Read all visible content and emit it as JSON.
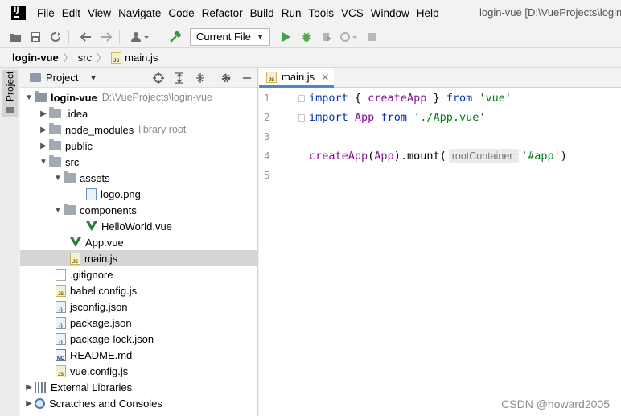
{
  "menu": {
    "items": [
      "File",
      "Edit",
      "View",
      "Navigate",
      "Code",
      "Refactor",
      "Build",
      "Run",
      "Tools",
      "VCS",
      "Window",
      "Help"
    ],
    "window_title": "login-vue [D:\\VueProjects\\login"
  },
  "toolbar": {
    "run_config": "Current File",
    "icons": [
      "open-folder-icon",
      "save-icon",
      "sync-icon",
      "back-arrow-icon",
      "forward-arrow-icon",
      "user-icon",
      "hammer-icon",
      "run-icon",
      "debug-icon",
      "coverage-icon",
      "profile-icon",
      "stop-icon"
    ]
  },
  "breadcrumb": {
    "project": "login-vue",
    "folder": "src",
    "file": "main.js"
  },
  "tool_strip": {
    "project_tab": "Project"
  },
  "project_panel": {
    "title": "Project",
    "tree": [
      {
        "label": "login-vue",
        "hint": "D:\\VueProjects\\login-vue",
        "depth": 0,
        "arrow": "down",
        "icon": "folder-dark",
        "bold": true
      },
      {
        "label": ".idea",
        "depth": 1,
        "arrow": "right",
        "icon": "folder"
      },
      {
        "label": "node_modules",
        "hint": "library root",
        "depth": 1,
        "arrow": "right",
        "icon": "folder"
      },
      {
        "label": "public",
        "depth": 1,
        "arrow": "right",
        "icon": "folder"
      },
      {
        "label": "src",
        "depth": 1,
        "arrow": "down",
        "icon": "folder"
      },
      {
        "label": "assets",
        "depth": 2,
        "arrow": "down",
        "icon": "folder"
      },
      {
        "label": "logo.png",
        "depth": 3,
        "icon": "png"
      },
      {
        "label": "components",
        "depth": 2,
        "arrow": "down",
        "icon": "folder"
      },
      {
        "label": "HelloWorld.vue",
        "depth": 3,
        "icon": "vue"
      },
      {
        "label": "App.vue",
        "depth": 2,
        "icon": "vue"
      },
      {
        "label": "main.js",
        "depth": 2,
        "icon": "js",
        "selected": true
      },
      {
        "label": ".gitignore",
        "depth": 1,
        "icon": "git"
      },
      {
        "label": "babel.config.js",
        "depth": 1,
        "icon": "js"
      },
      {
        "label": "jsconfig.json",
        "depth": 1,
        "icon": "json"
      },
      {
        "label": "package.json",
        "depth": 1,
        "icon": "json"
      },
      {
        "label": "package-lock.json",
        "depth": 1,
        "icon": "json"
      },
      {
        "label": "README.md",
        "depth": 1,
        "icon": "md"
      },
      {
        "label": "vue.config.js",
        "depth": 1,
        "icon": "js"
      },
      {
        "label": "External Libraries",
        "depth": 0,
        "arrow": "right",
        "icon": "lib"
      },
      {
        "label": "Scratches and Consoles",
        "depth": 0,
        "arrow": "right",
        "icon": "scratch"
      }
    ]
  },
  "editor": {
    "tab_label": "main.js",
    "line_numbers": [
      "1",
      "2",
      "3",
      "4",
      "5"
    ],
    "line1": {
      "kw1": "import",
      "brace_open": " { ",
      "name": "createApp",
      "brace_close": " } ",
      "kw2": "from",
      "sp": " ",
      "str": "'vue'"
    },
    "line2": {
      "kw1": "import",
      "sp1": " ",
      "name": "App",
      "sp2": " ",
      "kw2": "from",
      "sp3": " ",
      "str": "'./App.vue'"
    },
    "line4": {
      "fn": "createApp",
      "paren_open": "(",
      "arg": "App",
      "mid": ").mount(",
      "hint": "rootContainer:",
      "str": "'#app'",
      "paren_close": ")"
    }
  },
  "watermark": "CSDN @howard2005"
}
